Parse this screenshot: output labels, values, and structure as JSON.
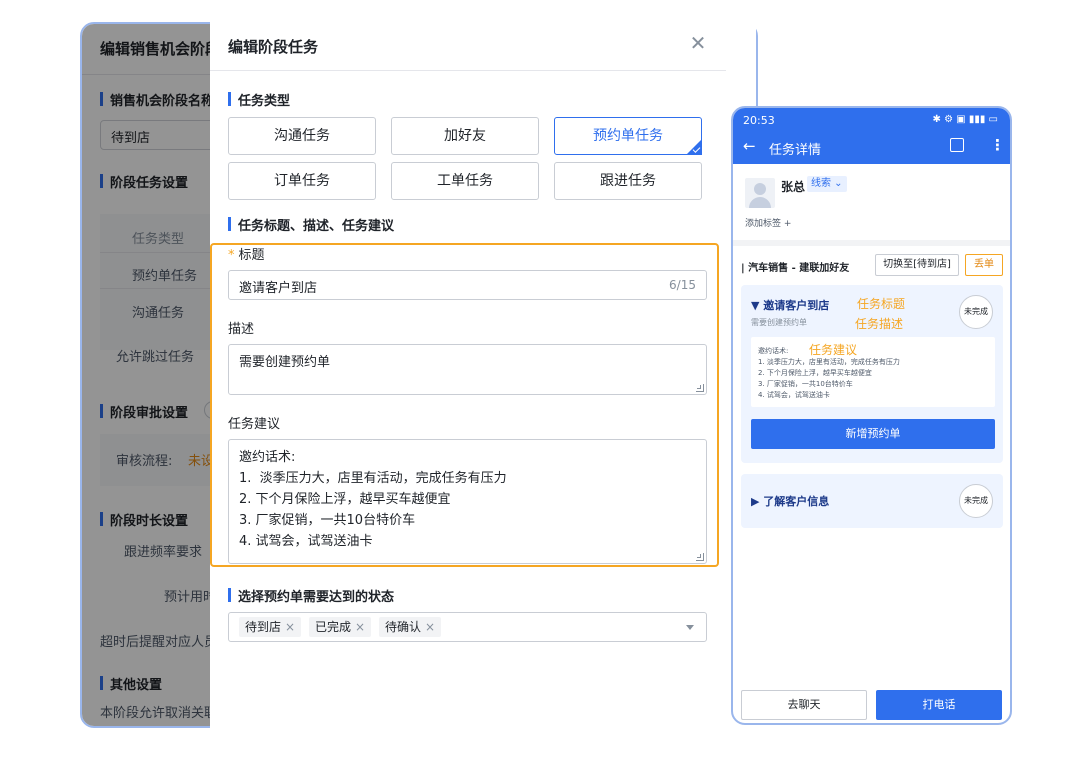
{
  "background_dialog": {
    "title": "编辑销售机会阶段",
    "section_stage_name": "销售机会阶段名称",
    "stage_name_value": "待到店",
    "section_task_settings": "阶段任务设置",
    "table_header": "任务类型",
    "row1": "预约单任务",
    "row2": "沟通任务",
    "allow_skip": "允许跳过任务",
    "section_approval": "阶段审批设置",
    "approval_flow_label": "审核流程:",
    "approval_flow_value": "未设",
    "section_duration": "阶段时长设置",
    "follow_freq": "跟进频率要求",
    "estimated_time": "预计用时",
    "timeout_remind": "超时后提醒对应人员",
    "section_other": "其他设置",
    "allow_cancel": "本阶段允许取消关联"
  },
  "modal": {
    "title": "编辑阶段任务",
    "close_icon": "close-icon",
    "section_task_type": "任务类型",
    "task_types": [
      "沟通任务",
      "加好友",
      "预约单任务",
      "订单任务",
      "工单任务",
      "跟进任务"
    ],
    "selected_task_type": "预约单任务",
    "section_title_desc": "任务标题、描述、任务建议",
    "title_label": "标题",
    "title_required_mark": "*",
    "title_value": "邀请客户到店",
    "title_counter": "6/15",
    "desc_label": "描述",
    "desc_value": "需要创建预约单",
    "advice_label": "任务建议",
    "advice_lines": [
      "邀约话术:",
      "1.  淡季压力大，店里有活动，完成任务有压力",
      "2. 下个月保险上浮，越早买车越便宜",
      "3. 厂家促销，一共10台特价车",
      "4. 试驾会，试驾送油卡"
    ],
    "section_status": "选择预约单需要达到的状态",
    "status_tags": [
      "待到店",
      "已完成",
      "待确认"
    ]
  },
  "phone": {
    "status_time": "20:53",
    "status_icons": "✱ ⚙ ▣ ▮▮▮ ▭",
    "title": "任务详情",
    "contact_name": "张总",
    "lead_label": "线索",
    "add_tag": "添加标签 +",
    "stage_title": "汽车销售 - 建联加好友",
    "switch_btn": "切换至[待到店]",
    "drop_btn": "丢单",
    "card1": {
      "title": "邀请客户到店",
      "sub": "需要创建预约单",
      "anno_title": "任务标题",
      "anno_desc": "任务描述",
      "status": "未完成",
      "advice_head": "邀约话术:",
      "anno_advice": "任务建议",
      "advice_lines": [
        "1. 淡季压力大，店里有活动，完成任务有压力",
        "2. 下个月保险上浮，越早买车越便宜",
        "3. 厂家促销，一共10台特价车",
        "4. 试驾会，试驾送油卡"
      ],
      "button": "新增预约单"
    },
    "card2": {
      "title": "了解客户信息",
      "status": "未完成"
    },
    "footer_left": "去聊天",
    "footer_right": "打电话"
  },
  "colors": {
    "primary": "#2f6fed",
    "highlight": "#f5a623",
    "border": "#9ab6ec"
  }
}
